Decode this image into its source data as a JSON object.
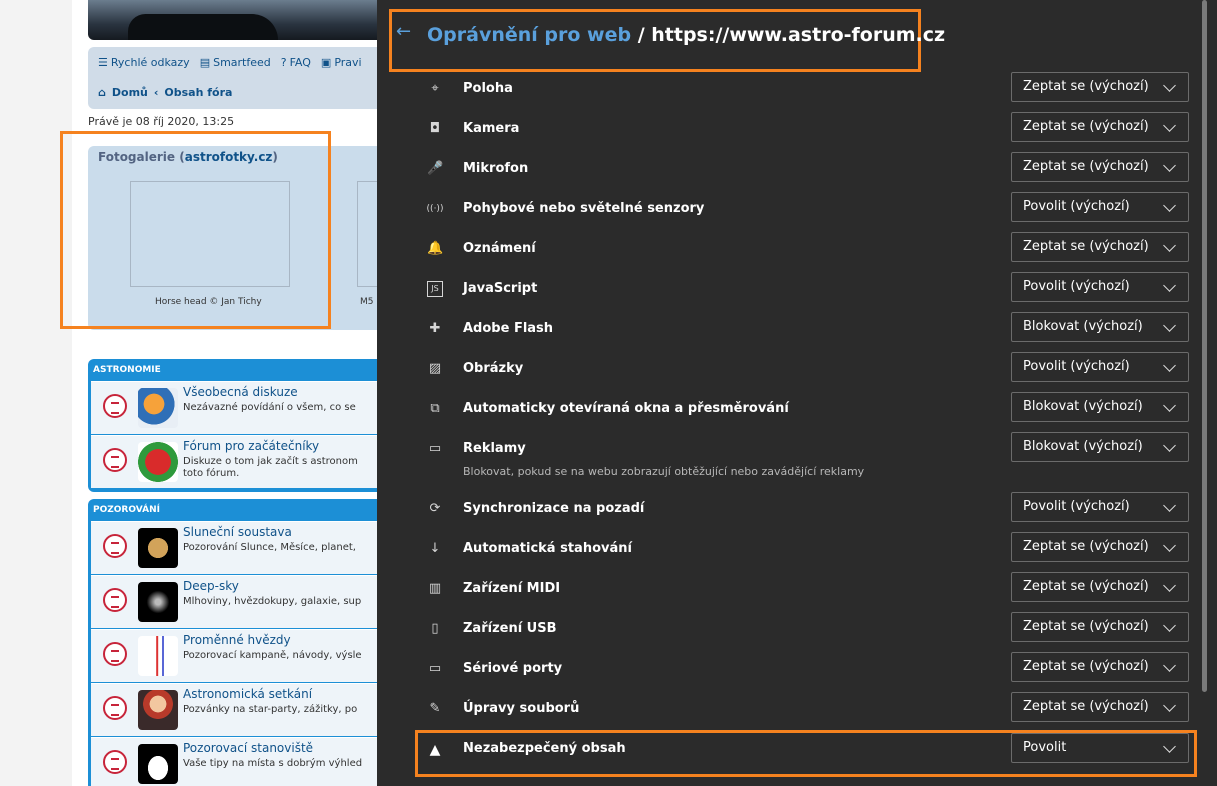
{
  "forum": {
    "quicklinks": [
      "Rychlé odkazy",
      "Smartfeed",
      "FAQ",
      "Pravi"
    ],
    "breadcrumb": {
      "home": "Domů",
      "forum_index": "Obsah fóra"
    },
    "datetime": "Právě je 08 říj 2020, 13:25",
    "gallery": {
      "title_prefix": "Fotogalerie (",
      "title_link": "astrofotky.cz",
      "title_suffix": ")",
      "items": [
        {
          "caption": "Horse head © Jan Tichy"
        },
        {
          "caption": "M5"
        }
      ]
    },
    "categories": [
      {
        "title": "ASTRONOMIE",
        "forums": [
          {
            "name": "Všeobecná diskuze",
            "desc": "Nezávazné povídání o všem, co se",
            "desc2": ""
          },
          {
            "name": "Fórum pro začátečníky",
            "desc": "Diskuze o tom jak začít s astronom",
            "desc2": "toto fórum."
          }
        ]
      },
      {
        "title": "POZOROVÁNÍ",
        "forums": [
          {
            "name": "Sluneční soustava",
            "desc": "Pozorování Slunce, Měsíce, planet,",
            "desc2": ""
          },
          {
            "name": "Deep-sky",
            "desc": "Mlhoviny, hvězdokupy, galaxie, sup",
            "desc2": ""
          },
          {
            "name": "Proměnné hvězdy",
            "desc": "Pozorovací kampaně, návody, výsle",
            "desc2": ""
          },
          {
            "name": "Astronomická setkání",
            "desc": "Pozvánky na star-party, zážitky, po",
            "desc2": ""
          },
          {
            "name": "Pozorovací stanoviště",
            "desc": "Vaše tipy na místa s dobrým výhled",
            "desc2": ""
          }
        ]
      }
    ]
  },
  "panel": {
    "back_icon": "arrow-left-icon",
    "title": "Oprávnění pro web",
    "separator": " / ",
    "url": "https://www.astro-forum.cz",
    "accent_color": "#5aa0dc",
    "highlight_color": "#f5821f",
    "permissions": [
      {
        "icon": "location-pin-icon",
        "label": "Poloha",
        "value": "Zeptat se (výchozí)"
      },
      {
        "icon": "camera-icon",
        "label": "Kamera",
        "value": "Zeptat se (výchozí)"
      },
      {
        "icon": "microphone-icon",
        "label": "Mikrofon",
        "value": "Zeptat se (výchozí)"
      },
      {
        "icon": "sensor-icon",
        "label": "Pohybové nebo světelné senzory",
        "value": "Povolit (výchozí)"
      },
      {
        "icon": "bell-icon",
        "label": "Oznámení",
        "value": "Zeptat se (výchozí)"
      },
      {
        "icon": "javascript-icon",
        "label": "JavaScript",
        "value": "Povolit (výchozí)"
      },
      {
        "icon": "puzzle-icon",
        "label": "Adobe Flash",
        "value": "Blokovat (výchozí)"
      },
      {
        "icon": "image-icon",
        "label": "Obrázky",
        "value": "Povolit (výchozí)"
      },
      {
        "icon": "popup-icon",
        "label": "Automaticky otevíraná okna a přesměrování",
        "value": "Blokovat (výchozí)"
      },
      {
        "icon": "ads-icon",
        "label": "Reklamy",
        "value": "Blokovat (výchozí)",
        "sub": "Blokovat, pokud se na webu zobrazují obtěžující nebo zavádějící reklamy"
      },
      {
        "icon": "sync-icon",
        "label": "Synchronizace na pozadí",
        "value": "Povolit (výchozí)"
      },
      {
        "icon": "download-icon",
        "label": "Automatická stahování",
        "value": "Zeptat se (výchozí)"
      },
      {
        "icon": "midi-icon",
        "label": "Zařízení MIDI",
        "value": "Zeptat se (výchozí)"
      },
      {
        "icon": "usb-icon",
        "label": "Zařízení USB",
        "value": "Zeptat se (výchozí)"
      },
      {
        "icon": "serial-port-icon",
        "label": "Sériové porty",
        "value": "Zeptat se (výchozí)"
      },
      {
        "icon": "file-edit-icon",
        "label": "Úpravy souborů",
        "value": "Zeptat se (výchozí)"
      },
      {
        "icon": "warning-icon",
        "label": "Nezabezpečený obsah",
        "value": "Povolit"
      }
    ]
  }
}
